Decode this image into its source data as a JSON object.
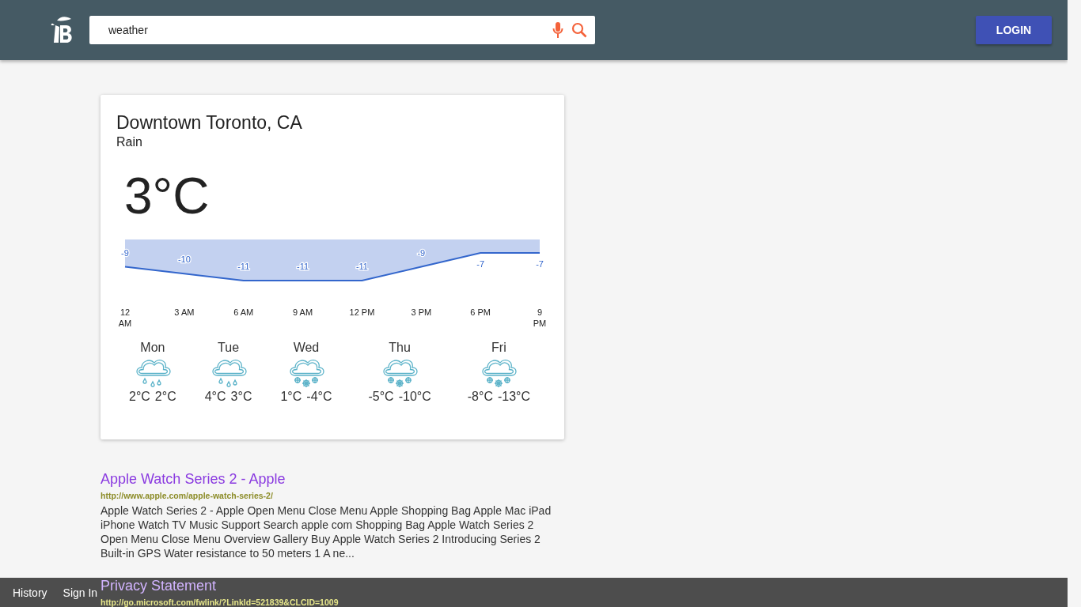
{
  "header": {
    "search": {
      "value": "weather"
    },
    "login_button": "LOGIN"
  },
  "weather": {
    "location": "Downtown Toronto, CA",
    "condition": "Rain",
    "temperature": "3°C",
    "chart_data": {
      "type": "area",
      "categories": [
        "12 AM",
        "3 AM",
        "6 AM",
        "9 AM",
        "12 PM",
        "3 PM",
        "6 PM",
        "9 PM"
      ],
      "series": [
        {
          "color": "#3366cc",
          "values": [
            -9,
            -10,
            -11,
            -11,
            -11,
            -9,
            -7,
            -7
          ]
        }
      ],
      "data_labels": true
    },
    "forecast": [
      {
        "day": "Mon",
        "kind": "rain",
        "high": "2°C",
        "low": "2°C"
      },
      {
        "day": "Tue",
        "kind": "rain",
        "high": "4°C",
        "low": "3°C"
      },
      {
        "day": "Wed",
        "kind": "snow",
        "high": "1°C",
        "low": "-4°C"
      },
      {
        "day": "Thu",
        "kind": "snow",
        "high": "-5°C",
        "low": "-10°C"
      },
      {
        "day": "Fri",
        "kind": "snow",
        "high": "-8°C",
        "low": "-13°C"
      }
    ]
  },
  "results": [
    {
      "title": "Apple Watch Series 2 - Apple",
      "url": "http://www.apple.com/apple-watch-series-2/",
      "snippet": "Apple Watch Series 2 - Apple Open Menu Close Menu Apple Shopping Bag Apple Mac iPad iPhone Watch TV Music Support Search apple com Shopping Bag Apple Watch Series 2 Open Menu Close Menu Overview Gallery Buy Apple Watch Series 2 Introducing Series 2 Built-in GPS Water resistance to 50 meters 1 A ne..."
    },
    {
      "title": "Privacy Statement",
      "url": "http://go.microsoft.com/fwlink/?LinkId=521839&CLCID=1009"
    }
  ],
  "bottom_bar": [
    "History",
    "Sign In"
  ]
}
